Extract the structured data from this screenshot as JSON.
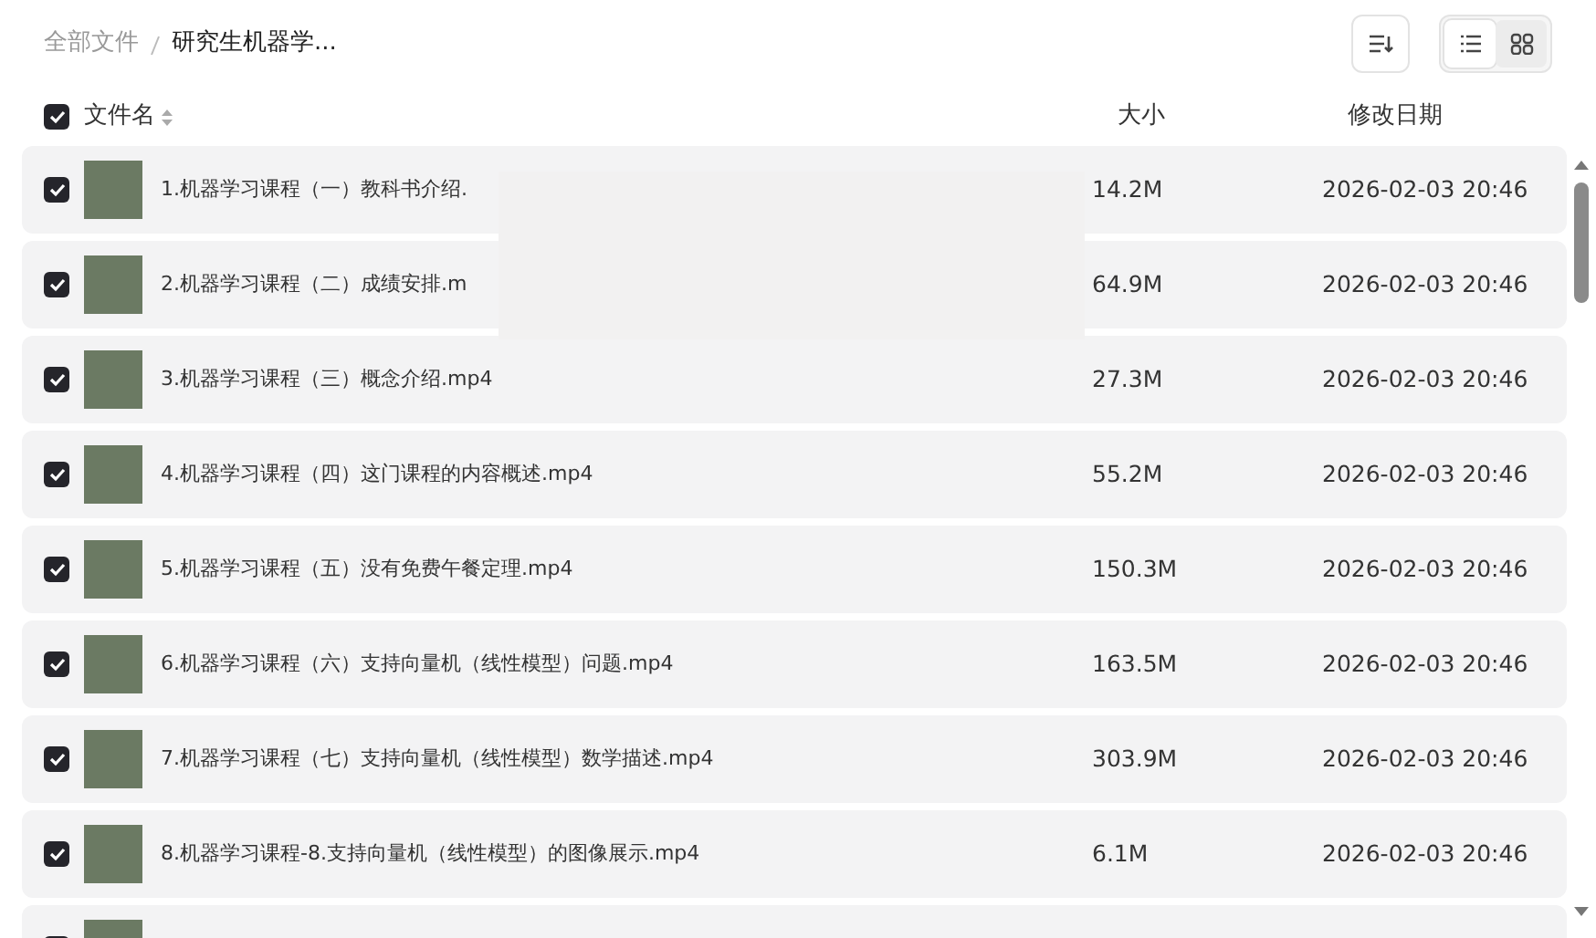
{
  "breadcrumb": [
    {
      "label": "全部文件",
      "current": false
    },
    {
      "label": "研究生机器学...",
      "current": true
    }
  ],
  "view_buttons": [
    {
      "kind": "list",
      "selected": true
    },
    {
      "kind": "grid",
      "selected": false
    }
  ],
  "header": {
    "all_checked": true,
    "columns": [
      "文件名",
      "大小",
      "修改日期"
    ]
  },
  "files": [
    {
      "name": "1.机器学习课程（一）教科书介绍.",
      "size": "14.2M",
      "modified": "2026-02-03 20:46",
      "selected": true
    },
    {
      "name": "2.机器学习课程（二）成绩安排.m",
      "size": "64.9M",
      "modified": "2026-02-03 20:46",
      "selected": true
    },
    {
      "name": "3.机器学习课程（三）概念介绍.mp4",
      "size": "27.3M",
      "modified": "2026-02-03 20:46",
      "selected": true
    },
    {
      "name": "4.机器学习课程（四）这门课程的内容概述.mp4",
      "size": "55.2M",
      "modified": "2026-02-03 20:46",
      "selected": true
    },
    {
      "name": "5.机器学习课程（五）没有免费午餐定理.mp4",
      "size": "150.3M",
      "modified": "2026-02-03 20:46",
      "selected": true
    },
    {
      "name": "6.机器学习课程（六）支持向量机（线性模型）问题.mp4",
      "size": "163.5M",
      "modified": "2026-02-03 20:46",
      "selected": true
    },
    {
      "name": "7.机器学习课程（七）支持向量机（线性模型）数学描述.mp4",
      "size": "303.9M",
      "modified": "2026-02-03 20:46",
      "selected": true
    },
    {
      "name": "8.机器学习课程-8.支持向量机（线性模型）的图像展示.mp4",
      "size": "6.1M",
      "modified": "2026-02-03 20:46",
      "selected": true
    },
    {
      "selected": true
    }
  ]
}
